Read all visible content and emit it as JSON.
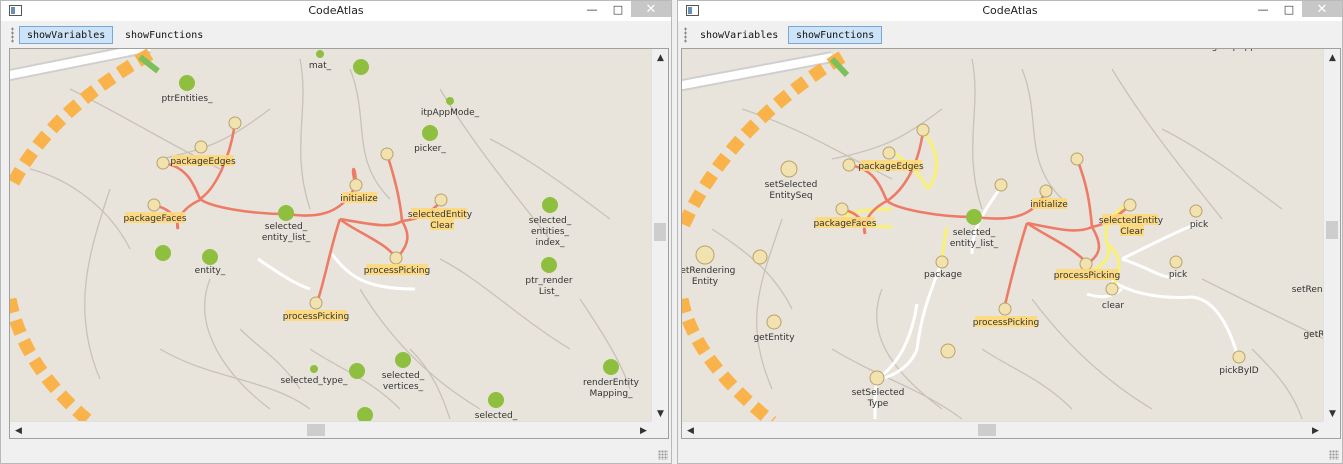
{
  "left_window": {
    "title": "CodeAtlas",
    "window_buttons": {
      "minimize": "—",
      "maximize": "□",
      "close": "✕"
    },
    "toolbar": {
      "show_variables": "showVariables",
      "show_functions": "showFunctions",
      "active": "showVariables"
    },
    "nodes": {
      "mat": "mat_",
      "ptr_entities": "ptrEntities_",
      "itp_app_mode": "itpAppMode_",
      "picker": "picker_",
      "package_edges": "packageEdges",
      "initialize": "initialize",
      "selected_entity_clear_1": "selectedEntity",
      "selected_entity_clear_2": "Clear",
      "package_faces": "packageFaces",
      "selected_entity_list_1": "selected_",
      "selected_entity_list_2": "entity_list_",
      "selected_entities_index_1": "selected_",
      "selected_entities_index_2": "entities_",
      "selected_entities_index_3": "index_",
      "entity": "entity_",
      "process_picking_a": "processPicking",
      "ptr_render_list_1": "ptr_render",
      "ptr_render_list_2": "List_",
      "process_picking_b": "processPicking",
      "selected_type": "selected_type_",
      "selected_vertices_1": "selected_",
      "selected_vertices_2": "vertices_",
      "render_entity_mapping_1": "renderEntity",
      "render_entity_mapping_2": "Mapping_",
      "selected_bottom": "selected_"
    }
  },
  "right_window": {
    "title": "CodeAtlas",
    "window_buttons": {
      "minimize": "—",
      "maximize": "□",
      "close": "✕"
    },
    "toolbar": {
      "show_variables": "showVariables",
      "show_functions": "showFunctions",
      "active": "showFunctions"
    },
    "nodes": {
      "get_itp_app_mode": "getItpAppMode",
      "set_selected_entity_seq_1": "setSelected",
      "set_selected_entity_seq_2": "EntitySeq",
      "package_edges": "packageEdges",
      "initialize": "initialize",
      "selected_entity_clear_1": "selectedEntity",
      "selected_entity_clear_2": "Clear",
      "pick_a": "pick",
      "package_faces": "packageFaces",
      "selected_entity_list_1": "selected_",
      "selected_entity_list_2": "entity_list_",
      "get_rendering_entity_1": "getRendering",
      "get_rendering_entity_2": "Entity",
      "package": "package",
      "process_picking_a": "processPicking",
      "pick_b": "pick",
      "set_rend": "setRend",
      "clear": "clear",
      "get_entity": "getEntity",
      "process_picking_b": "processPicking",
      "get_r": "getR",
      "set_selected_type_1": "setSelected",
      "set_selected_type_2": "Type",
      "pick_by_id": "pickByID"
    }
  },
  "colors": {
    "map_background": "#e8e4dc",
    "variable_node": "#8fbf3f",
    "function_node": "#f1e2b0",
    "highlight_edge": "#ee7b66",
    "call_edge_yellow": "#f7f07a",
    "route_dash": "#f9b34a",
    "label_highlight": "#ffd97a",
    "active_button": "#cde3f7"
  }
}
